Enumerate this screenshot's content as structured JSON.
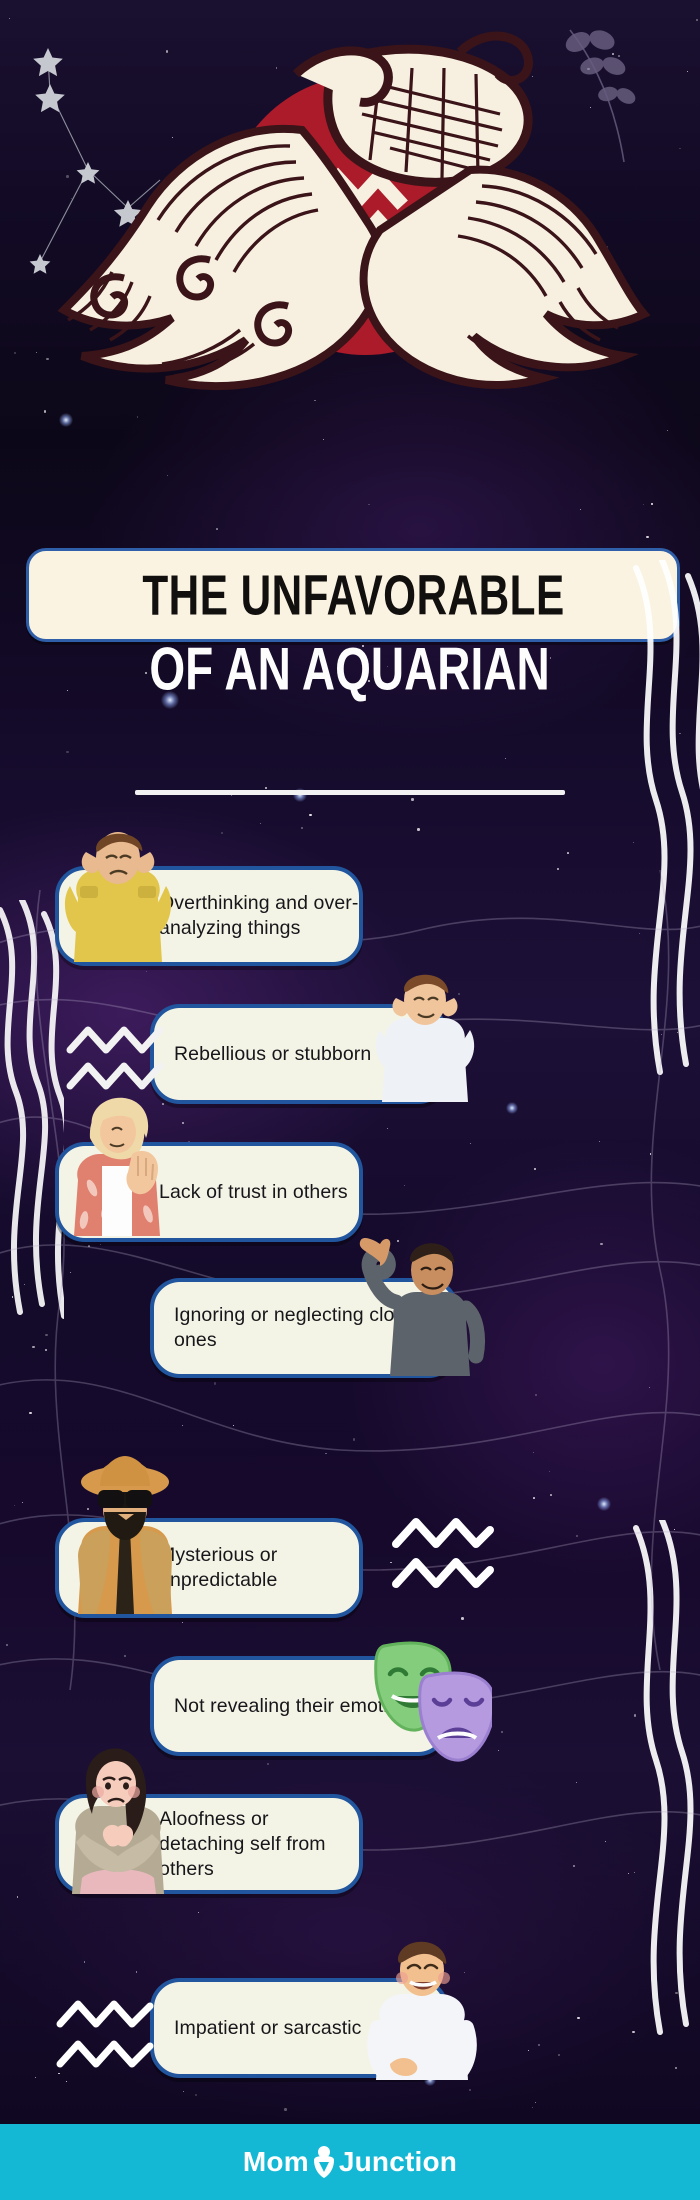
{
  "header": {
    "title_line1": "THE UNFAVORABLE",
    "title_line2": "OF AN AQUARIAN",
    "zodiac_sign": "Aquarius",
    "hero_icon": "aquarius-water-bearer-illustration",
    "hero_glyph": "aquarius-glyph",
    "accent_red": "#ab1b2a",
    "accent_cream": "#f7f0e0",
    "accent_dark": "#3a1418"
  },
  "theme": {
    "background_dark": "#130b26",
    "background_purple": "#2b1448",
    "card_fill": "#f4f4e6",
    "card_border": "#21569e",
    "title_band_fill": "#faf3e2",
    "title_band_border": "#2f5fa8",
    "footer_bg": "#14b8d4",
    "text_dark": "#17161a",
    "title_text": "#fdfdfd"
  },
  "traits": [
    {
      "index": 1,
      "label": "Overthinking and over-analyzing things",
      "align": "left",
      "illustration": "man-holding-head-stressed-icon"
    },
    {
      "index": 2,
      "label": "Rebellious or stubborn",
      "align": "right",
      "illustration": "man-covering-ears-icon",
      "decoration": "aquarius-glyph"
    },
    {
      "index": 3,
      "label": "Lack of trust in others",
      "align": "left",
      "illustration": "woman-hand-stop-gesture-icon"
    },
    {
      "index": 4,
      "label": "Ignoring or neglecting close ones",
      "align": "right",
      "illustration": "man-shrugging-dismissive-icon"
    },
    {
      "index": 5,
      "label": "Mysterious or unpredictable",
      "align": "left",
      "illustration": "man-in-hat-and-sunglasses-icon",
      "decoration": "aquarius-glyph"
    },
    {
      "index": 6,
      "label": "Not revealing their emotions",
      "align": "right",
      "illustration": "theater-masks-icon"
    },
    {
      "index": 7,
      "label": "Aloofness or detaching self from others",
      "align": "left",
      "illustration": "woman-arms-crossed-icon"
    },
    {
      "index": 8,
      "label": "Impatient or sarcastic",
      "align": "right",
      "illustration": "man-laughing-sarcastic-icon",
      "decoration": "aquarius-glyph"
    }
  ],
  "footer": {
    "brand_first": "Mom",
    "brand_second": "Junction",
    "brand_mark": "momjunction-logo-icon"
  }
}
